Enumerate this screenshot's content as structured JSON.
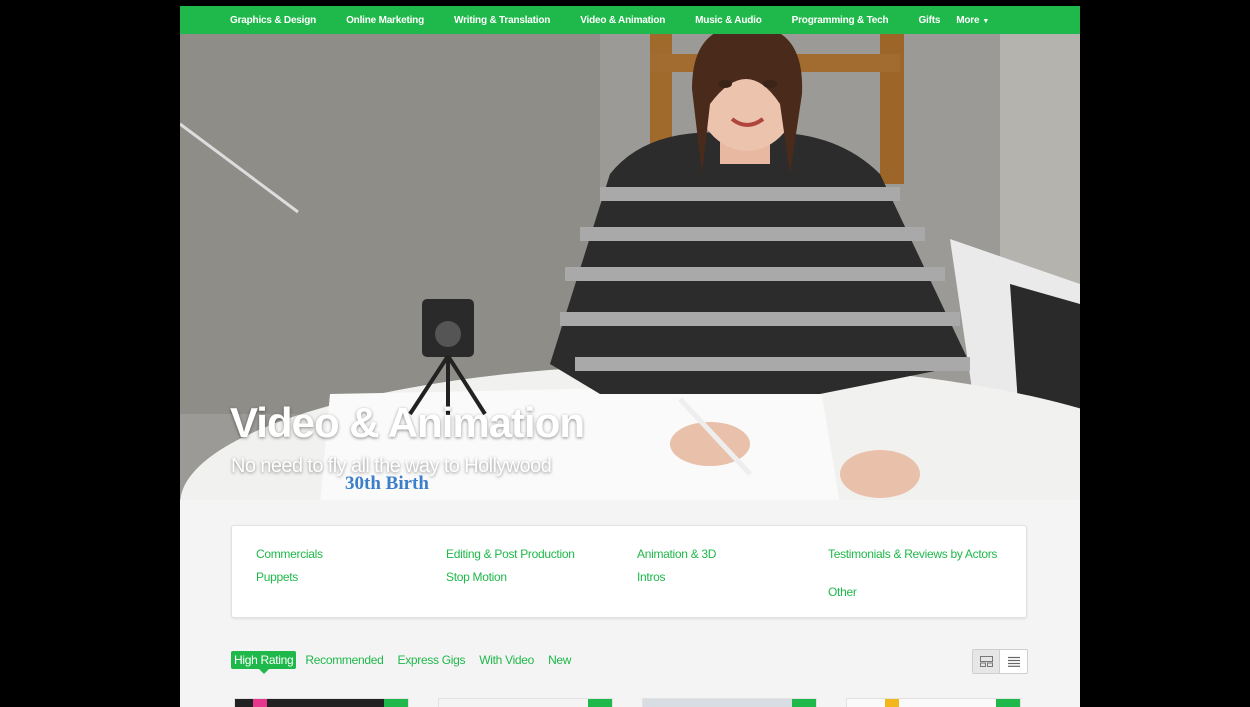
{
  "nav": {
    "items": [
      "Graphics & Design",
      "Online Marketing",
      "Writing & Translation",
      "Video & Animation",
      "Music & Audio",
      "Programming & Tech",
      "Gifts",
      "More"
    ]
  },
  "hero": {
    "title": "Video & Animation",
    "subtitle": "No need to fly all the way to Hollywood",
    "paper_text": "30th Birth"
  },
  "subcategories": {
    "col1": [
      "Commercials",
      "Puppets"
    ],
    "col2": [
      "Editing & Post Production",
      "Stop Motion"
    ],
    "col3": [
      "Animation & 3D",
      "Intros"
    ],
    "col4": [
      "Testimonials & Reviews by Actors",
      "Other"
    ]
  },
  "tabs": [
    "High Rating",
    "Recommended",
    "Express Gigs",
    "With Video",
    "New"
  ],
  "view_icons": {
    "grid": "grid-view-icon",
    "list": "list-view-icon"
  },
  "colors": {
    "accent": "#1fb84a"
  }
}
